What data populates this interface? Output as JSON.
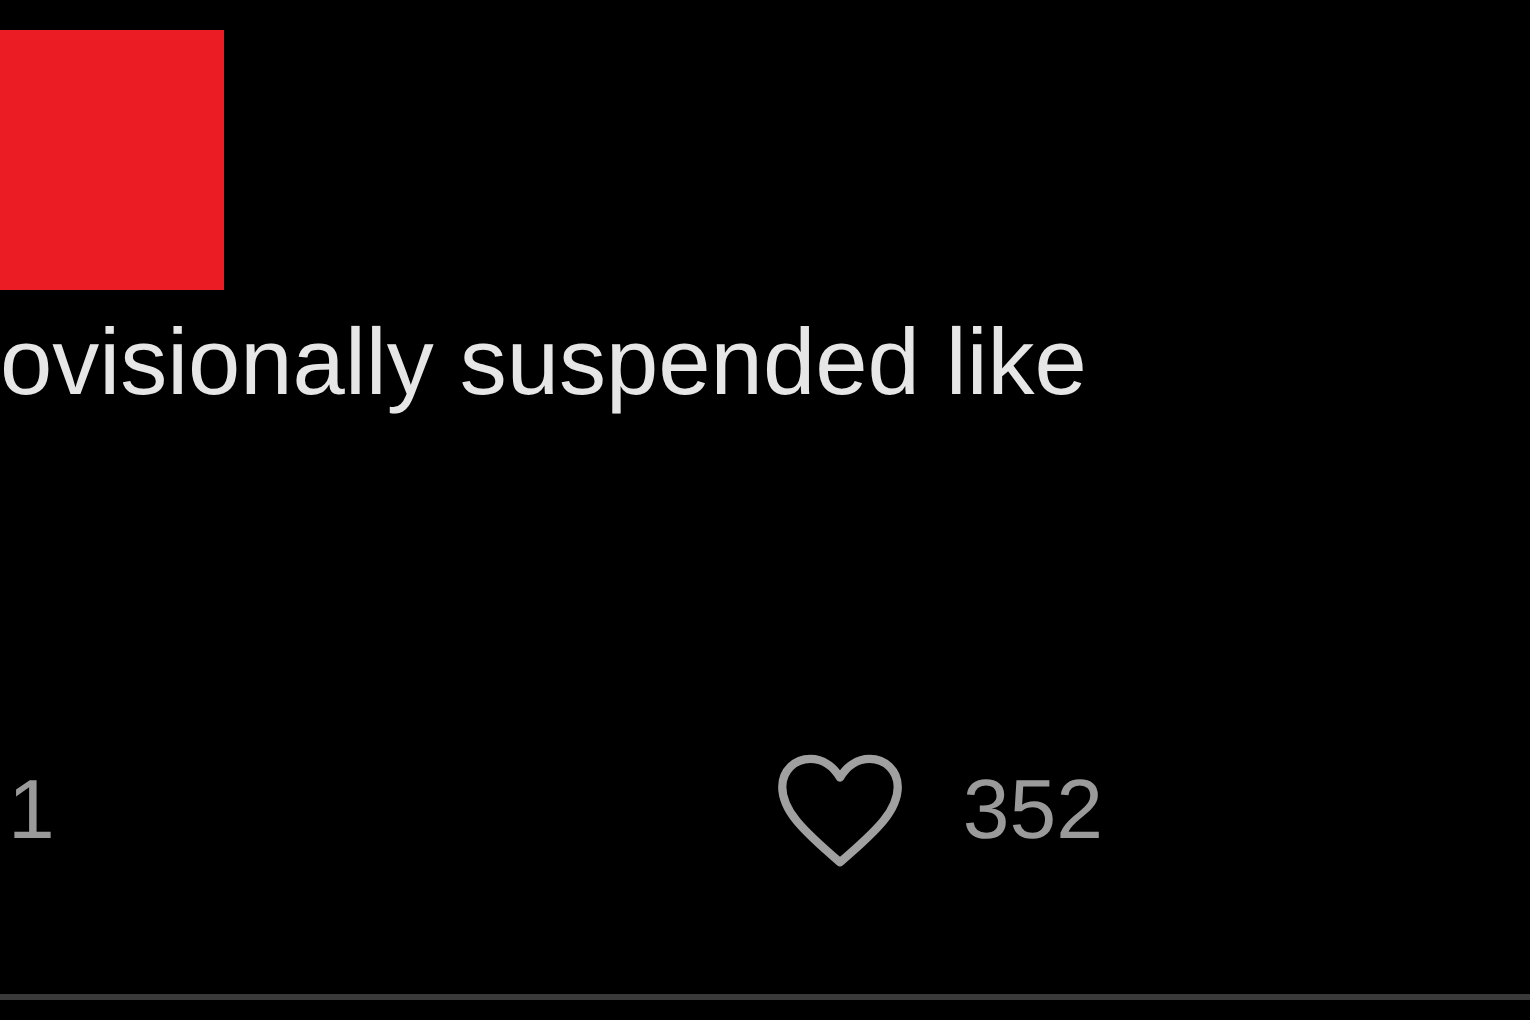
{
  "post": {
    "text": "ovisionally suspended like",
    "actions": [
      {
        "kind": "count",
        "count": "1"
      },
      {
        "kind": "like",
        "count": "352",
        "liked": false
      }
    ]
  }
}
